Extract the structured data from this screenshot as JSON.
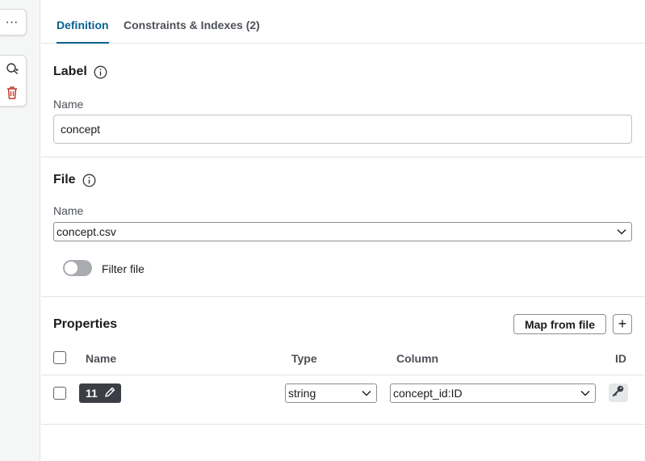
{
  "rail": {
    "more_label": "···",
    "icons": [
      "search-add-icon",
      "trash-icon"
    ]
  },
  "tabs": [
    {
      "label": "Definition",
      "active": true
    },
    {
      "label": "Constraints & Indexes (2)",
      "active": false
    }
  ],
  "label_section": {
    "title": "Label",
    "name_label": "Name",
    "name_value": "concept"
  },
  "file_section": {
    "title": "File",
    "name_label": "Name",
    "selected_file": "concept.csv",
    "filter_label": "Filter file",
    "filter_enabled": false
  },
  "properties_section": {
    "title": "Properties",
    "map_button": "Map from file",
    "add_button": "+",
    "headers": {
      "name": "Name",
      "type": "Type",
      "column": "Column",
      "id": "ID"
    },
    "rows": [
      {
        "name": "11",
        "type": "string",
        "column": "concept_id:ID",
        "is_id": true
      }
    ]
  },
  "colors": {
    "accent": "#0a6190",
    "chip_bg": "#3b3f45",
    "trash": "#c0392b"
  }
}
